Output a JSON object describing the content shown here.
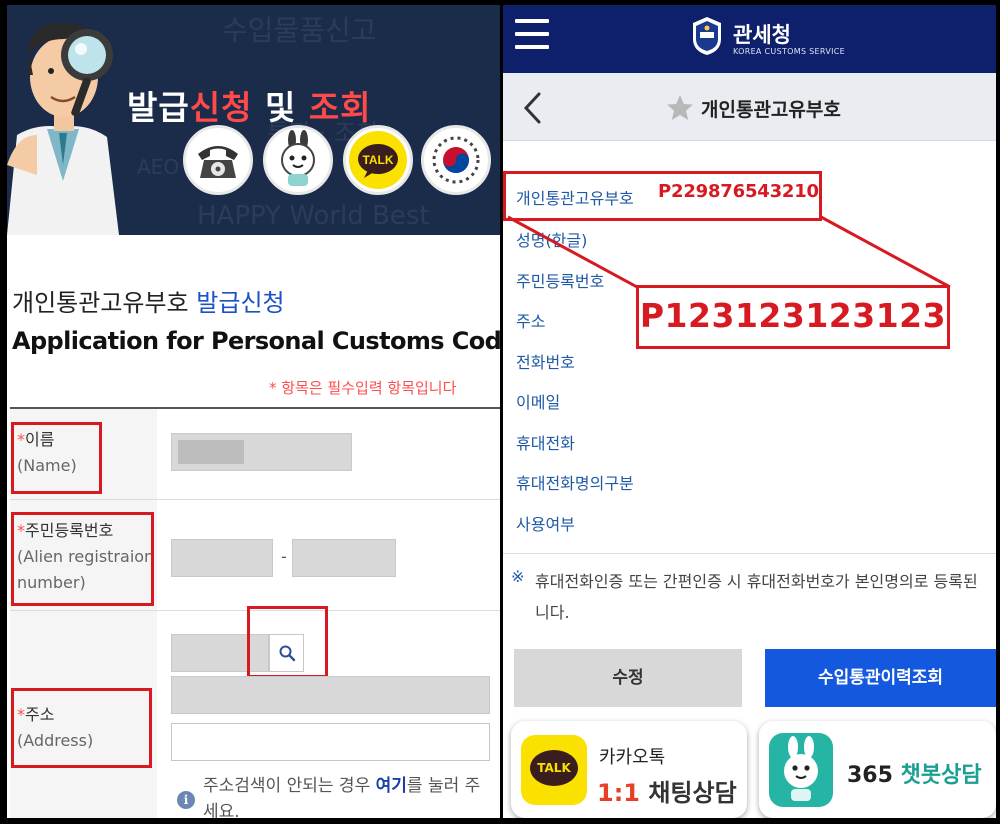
{
  "left": {
    "banner": {
      "title_part1": "발급",
      "title_part2": "신청",
      "title_part3": " 및 ",
      "title_part4": "조회",
      "talk_label": "TALK"
    },
    "heading_ko_plain": "개인통관고유부호 ",
    "heading_ko_blue": "발급신청",
    "heading_en": "Application for Personal Customs Code",
    "required_note": "* 항목은 필수입력 항목입니다",
    "fields": {
      "name": {
        "label": "이름",
        "label_en": "(Name)"
      },
      "alien": {
        "label": "주민등록번호",
        "label_en_1": "(Alien registraion",
        "label_en_2": "number)"
      },
      "address": {
        "label": "주소",
        "label_en": "(Address)"
      }
    },
    "dash": "-",
    "address_note_before": "주소검색이 안되는 경우 ",
    "address_note_link": "여기",
    "address_note_after": "를 눌러 주세요.",
    "info_mark": "i"
  },
  "right": {
    "header": {
      "logo_ko": "관세청",
      "logo_en": "KOREA CUSTOMS SERVICE"
    },
    "page_title": "개인통관고유부호",
    "fields": [
      "개인통관고유부호",
      "성명(한글)",
      "주민등록번호",
      "주소",
      "전화번호",
      "이메일",
      "휴대전화",
      "휴대전화명의구분",
      "사용여부"
    ],
    "code_value": "P229876543210",
    "big_code": "P123123123123",
    "note_mark": "※",
    "note_line1": "휴대전화인증 또는 간편인증 시 휴대전화번호가 본인명의로 등록된",
    "note_line2": "니다.",
    "edit_button": "수정",
    "history_button": "수입통관이력조회",
    "kakao_card": {
      "top": "카카오톡",
      "num": "1:1",
      "text": " 채팅상담",
      "icon_text": "TALK"
    },
    "chatbot_card": {
      "num": "365 ",
      "text": "챗봇상담"
    }
  },
  "colors": {
    "highlight_red": "#d71a21",
    "header_navy": "#0e1f6b",
    "link_blue": "#1f5aa6",
    "primary_button": "#1558e0"
  }
}
